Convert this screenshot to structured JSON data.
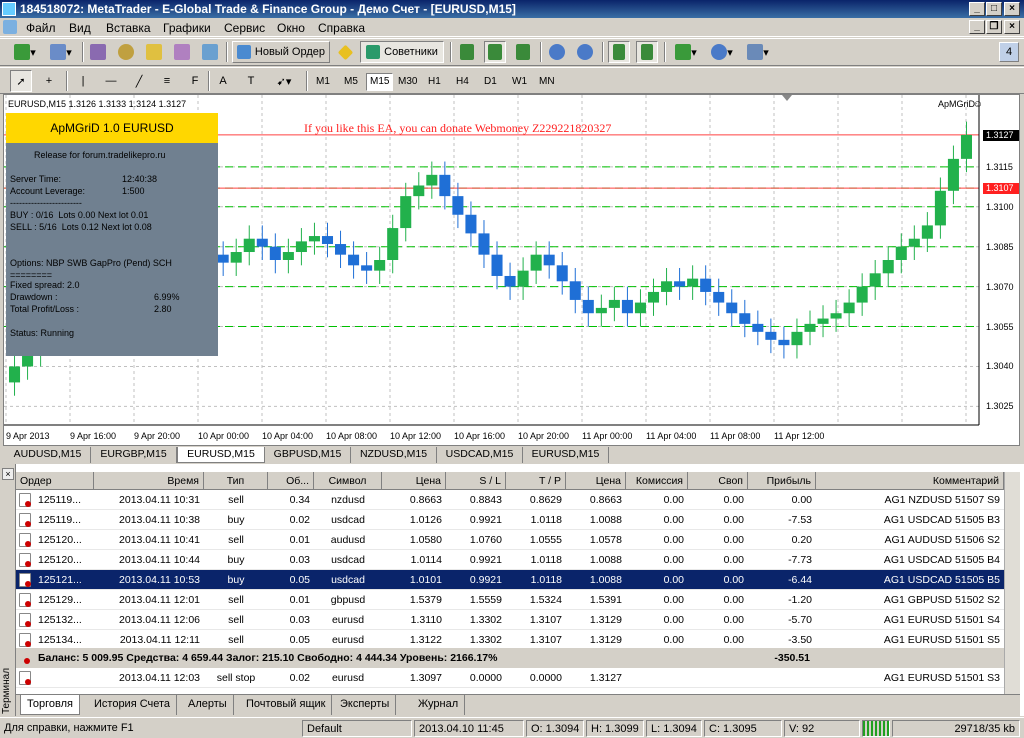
{
  "window": {
    "title": "184518072: MetaTrader - E-Global Trade & Finance Group - Демо Счет - [EURUSD,M15]"
  },
  "menu": [
    "Файл",
    "Вид",
    "Вставка",
    "Графики",
    "Сервис",
    "Окно",
    "Справка"
  ],
  "toolbar": {
    "new_order": "Новый Ордер",
    "advisors": "Советники",
    "badge": "4"
  },
  "timeframes": [
    "M1",
    "M5",
    "M15",
    "M30",
    "H1",
    "H4",
    "D1",
    "W1",
    "MN"
  ],
  "timeframe_selected": "M15",
  "chart": {
    "header": "EURUSD,M15  1.3126 1.3133 1.3124 1.3127",
    "ea_name": "ApMGriD",
    "donate_text": "If you like this EA, you can donate Webmoney Z229221820327",
    "price_labels": [
      "1.3127",
      "1.3115",
      "1.3107",
      "1.3100",
      "1.3085",
      "1.3070",
      "1.3055",
      "1.3040",
      "1.3025"
    ],
    "time_labels": [
      "9 Apr 2013",
      "9 Apr 16:00",
      "9 Apr 20:00",
      "10 Apr 00:00",
      "10 Apr 04:00",
      "10 Apr 08:00",
      "10 Apr 12:00",
      "10 Apr 16:00",
      "10 Apr 20:00",
      "11 Apr 00:00",
      "11 Apr 04:00",
      "11 Apr 08:00",
      "11 Apr 12:00"
    ],
    "colors": {
      "bull": "#22b14c",
      "bear": "#1f6fd6",
      "grid": "#c0c0c0",
      "level": "#00c000",
      "stop": "#ff4040"
    }
  },
  "chart_data": {
    "type": "candlestick",
    "title": "EURUSD,M15",
    "ylim": [
      1.3018,
      1.3142
    ],
    "close": [
      1.304,
      1.3045,
      1.305,
      1.3055,
      1.3062,
      1.3058,
      1.3068,
      1.3075,
      1.308,
      1.3085,
      1.3088,
      1.3083,
      1.308,
      1.3084,
      1.3086,
      1.3082,
      1.3079,
      1.3083,
      1.3088,
      1.3085,
      1.308,
      1.3083,
      1.3087,
      1.3089,
      1.3086,
      1.3082,
      1.3078,
      1.3076,
      1.308,
      1.3092,
      1.3104,
      1.3108,
      1.3112,
      1.3104,
      1.3097,
      1.309,
      1.3082,
      1.3074,
      1.307,
      1.3076,
      1.3082,
      1.3078,
      1.3072,
      1.3065,
      1.306,
      1.3062,
      1.3065,
      1.306,
      1.3064,
      1.3068,
      1.3072,
      1.307,
      1.3073,
      1.3068,
      1.3064,
      1.306,
      1.3056,
      1.3053,
      1.305,
      1.3048,
      1.3053,
      1.3056,
      1.3058,
      1.306,
      1.3064,
      1.307,
      1.3075,
      1.308,
      1.3085,
      1.3088,
      1.3093,
      1.3106,
      1.3118,
      1.3127
    ],
    "open": [
      1.3034,
      1.304,
      1.3045,
      1.305,
      1.3055,
      1.3062,
      1.3058,
      1.3068,
      1.3075,
      1.308,
      1.3085,
      1.3088,
      1.3083,
      1.308,
      1.3084,
      1.3086,
      1.3082,
      1.3079,
      1.3083,
      1.3088,
      1.3085,
      1.308,
      1.3083,
      1.3087,
      1.3089,
      1.3086,
      1.3082,
      1.3078,
      1.3076,
      1.308,
      1.3092,
      1.3104,
      1.3108,
      1.3112,
      1.3104,
      1.3097,
      1.309,
      1.3082,
      1.3074,
      1.307,
      1.3076,
      1.3082,
      1.3078,
      1.3072,
      1.3065,
      1.306,
      1.3062,
      1.3065,
      1.306,
      1.3064,
      1.3068,
      1.3072,
      1.307,
      1.3073,
      1.3068,
      1.3064,
      1.306,
      1.3056,
      1.3053,
      1.305,
      1.3048,
      1.3053,
      1.3056,
      1.3058,
      1.306,
      1.3064,
      1.307,
      1.3075,
      1.308,
      1.3085,
      1.3088,
      1.3093,
      1.3106,
      1.3118
    ],
    "level_lines": [
      1.3115,
      1.3107,
      1.31,
      1.3085,
      1.307,
      1.3055
    ],
    "stop_lines": [
      1.3127,
      1.3107
    ]
  },
  "ea_panel": {
    "title": "ApMGriD 1.0 EURUSD",
    "release": "Release for forum.tradelikepro.ru",
    "server_time_label": "Server Time:",
    "server_time": "12:40:38",
    "leverage_label": "Account Leverage:",
    "leverage": "1:500",
    "dashes": "------------------------",
    "buy": "BUY : 0/16  Lots 0.00 Next lot 0.01",
    "sell": "SELL : 5/16  Lots 0.12 Next lot 0.08",
    "options": "Options: NBP SWB GapPro (Pend) SCH",
    "equals": "========",
    "fixed_spread": "Fixed spread: 2.0",
    "drawdown_label": "Drawdown :",
    "drawdown": "6.99%",
    "profit_label": "Total Profit/Loss :",
    "profit": "2.80",
    "status": "Status: Running"
  },
  "chart_tabs": [
    "AUDUSD,M15",
    "EURGBP,M15",
    "EURUSD,M15",
    "GBPUSD,M15",
    "NZDUSD,M15",
    "USDCAD,M15",
    "EURUSD,M15"
  ],
  "chart_tab_active": 2,
  "terminal": {
    "side_label": "Терминал",
    "columns": [
      "Ордер",
      "Время",
      "Тип",
      "Об...",
      "Символ",
      "Цена",
      "S / L",
      "T / P",
      "Цена",
      "Комиссия",
      "Своп",
      "Прибыль",
      "Комментарий"
    ],
    "rows": [
      [
        "125119...",
        "2013.04.11 10:31",
        "sell",
        "0.34",
        "nzdusd",
        "0.8663",
        "0.8843",
        "0.8629",
        "0.8663",
        "0.00",
        "0.00",
        "0.00",
        "AG1 NZDUSD 51507 S9"
      ],
      [
        "125119...",
        "2013.04.11 10:38",
        "buy",
        "0.02",
        "usdcad",
        "1.0126",
        "0.9921",
        "1.0118",
        "1.0088",
        "0.00",
        "0.00",
        "-7.53",
        "AG1 USDCAD 51505 B3"
      ],
      [
        "125120...",
        "2013.04.11 10:41",
        "sell",
        "0.01",
        "audusd",
        "1.0580",
        "1.0760",
        "1.0555",
        "1.0578",
        "0.00",
        "0.00",
        "0.20",
        "AG1 AUDUSD 51506 S2"
      ],
      [
        "125120...",
        "2013.04.11 10:44",
        "buy",
        "0.03",
        "usdcad",
        "1.0114",
        "0.9921",
        "1.0118",
        "1.0088",
        "0.00",
        "0.00",
        "-7.73",
        "AG1 USDCAD 51505 B4"
      ],
      [
        "125121...",
        "2013.04.11 10:53",
        "buy",
        "0.05",
        "usdcad",
        "1.0101",
        "0.9921",
        "1.0118",
        "1.0088",
        "0.00",
        "0.00",
        "-6.44",
        "AG1 USDCAD 51505 B5"
      ],
      [
        "125129...",
        "2013.04.11 12:01",
        "sell",
        "0.01",
        "gbpusd",
        "1.5379",
        "1.5559",
        "1.5324",
        "1.5391",
        "0.00",
        "0.00",
        "-1.20",
        "AG1 GBPUSD 51502 S2"
      ],
      [
        "125132...",
        "2013.04.11 12:06",
        "sell",
        "0.03",
        "eurusd",
        "1.3110",
        "1.3302",
        "1.3107",
        "1.3129",
        "0.00",
        "0.00",
        "-5.70",
        "AG1 EURUSD 51501 S4"
      ],
      [
        "125134...",
        "2013.04.11 12:11",
        "sell",
        "0.05",
        "eurusd",
        "1.3122",
        "1.3302",
        "1.3107",
        "1.3129",
        "0.00",
        "0.00",
        "-3.50",
        "AG1 EURUSD 51501 S5"
      ]
    ],
    "selected_row": 4,
    "balance_text": "Баланс: 5 009.95  Средства: 4 659.44  Залог: 215.10  Свободно: 4 444.34  Уровень: 2166.17%",
    "balance_profit": "-350.51",
    "pending_row": [
      "",
      "2013.04.11 12:03",
      "sell stop",
      "0.02",
      "eurusd",
      "1.3097",
      "0.0000",
      "0.0000",
      "1.3127",
      "",
      "",
      "",
      "AG1 EURUSD 51501 S3"
    ],
    "tabs": [
      "Торговля",
      "История Счета",
      "Алерты",
      "Почтовый ящик",
      "Эксперты",
      "Журнал"
    ],
    "tab_active": 0
  },
  "status": {
    "help": "Для справки, нажмите F1",
    "profile": "Default",
    "datetime": "2013.04.10 11:45",
    "open": "O: 1.3094",
    "high": "H: 1.3099",
    "low": "L: 1.3094",
    "close": "C: 1.3095",
    "volume": "V: 92",
    "traffic": "29718/35 kb"
  }
}
